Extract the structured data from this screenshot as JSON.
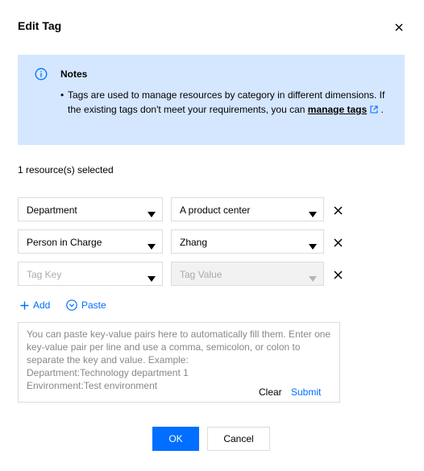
{
  "dialog": {
    "title": "Edit Tag",
    "close_icon": "close-icon"
  },
  "notes": {
    "icon": "info-icon",
    "title": "Notes",
    "text_before_link": "Tags are used to manage resources by category in different dimensions. If the existing tags don't meet your requirements, you can ",
    "link_label": "manage tags",
    "link_icon": "external-link-icon",
    "text_after_link": "."
  },
  "selected_count": "1 resource(s) selected",
  "tag_rows": [
    {
      "key": "Department",
      "value": "A product center",
      "value_disabled": false
    },
    {
      "key": "Person in Charge",
      "value": "Zhang",
      "value_disabled": false
    },
    {
      "key_placeholder": "Tag Key",
      "value_placeholder": "Tag Value",
      "value_disabled": true
    }
  ],
  "actions": {
    "add_label": "Add",
    "paste_label": "Paste"
  },
  "paste_area": {
    "placeholder": "You can paste key-value pairs here to automatically fill them. Enter one key-value pair per line and use a comma, semicolon, or colon to separate the key and value. Example:\nDepartment:Technology department 1\nEnvironment:Test environment",
    "clear_label": "Clear",
    "submit_label": "Submit"
  },
  "footer": {
    "ok_label": "OK",
    "cancel_label": "Cancel"
  },
  "colors": {
    "primary": "#006eff",
    "notes_background": "#d5e7ff",
    "border": "#dcdcdc",
    "placeholder": "#888888"
  }
}
